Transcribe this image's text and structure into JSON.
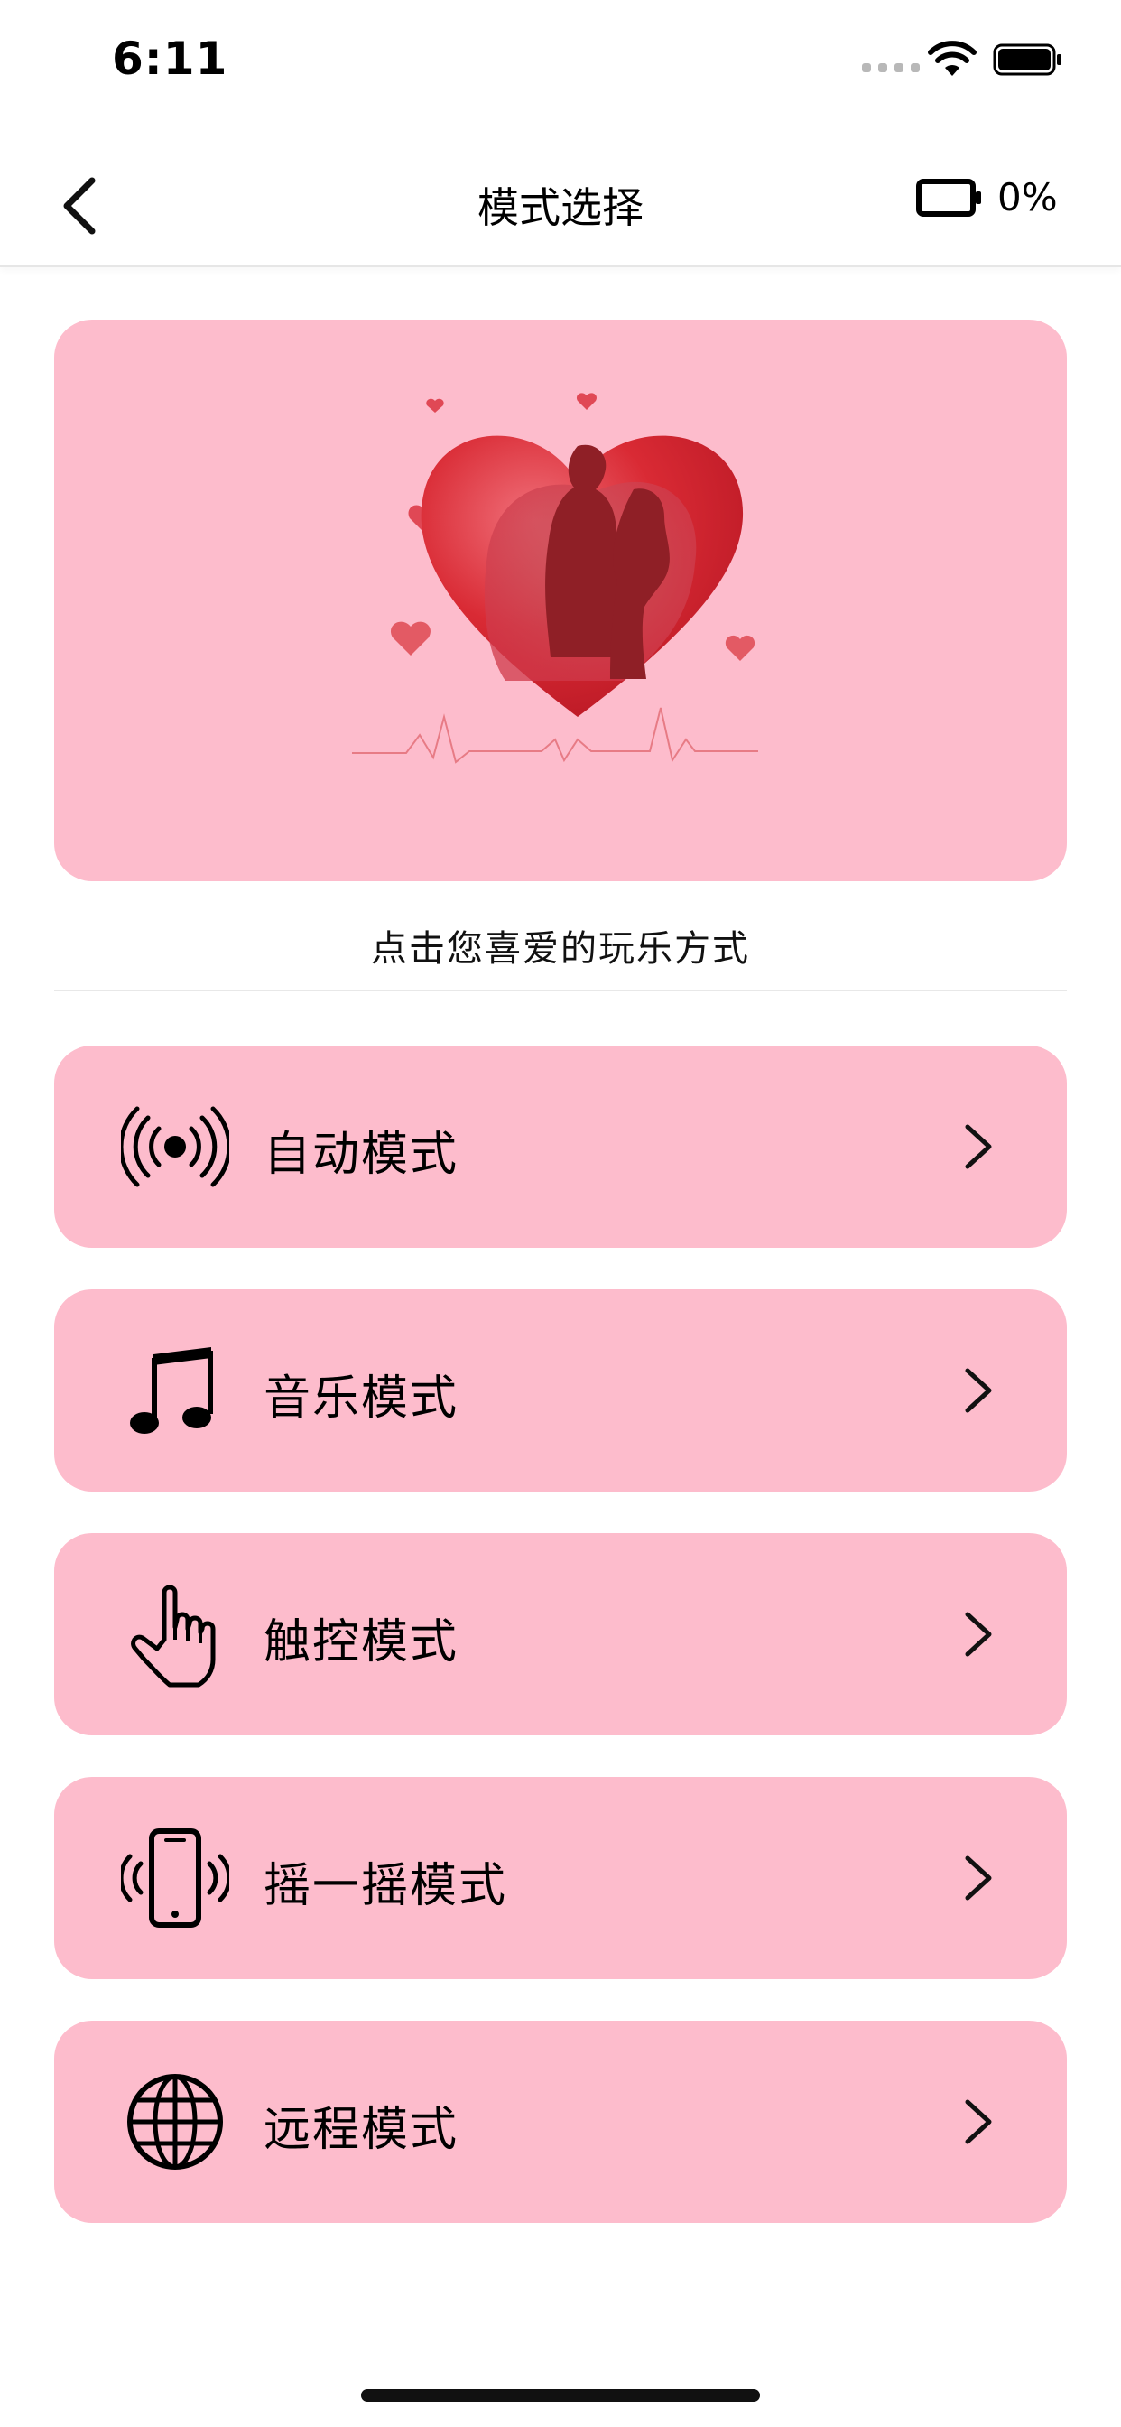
{
  "status_bar": {
    "time": "6:11"
  },
  "nav": {
    "title": "模式选择",
    "battery_percent": "0%"
  },
  "hero": {
    "image": "couple-heart-illustration"
  },
  "subtitle": "点击您喜爱的玩乐方式",
  "modes": [
    {
      "label": "自动模式",
      "icon": "broadcast-icon"
    },
    {
      "label": "音乐模式",
      "icon": "music-note-icon"
    },
    {
      "label": "触控模式",
      "icon": "pointing-hand-icon"
    },
    {
      "label": "摇一摇模式",
      "icon": "shake-phone-icon"
    },
    {
      "label": "远程模式",
      "icon": "globe-icon"
    }
  ],
  "colors": {
    "card_bg": "#fdbccc",
    "heart": "#d92a34"
  }
}
